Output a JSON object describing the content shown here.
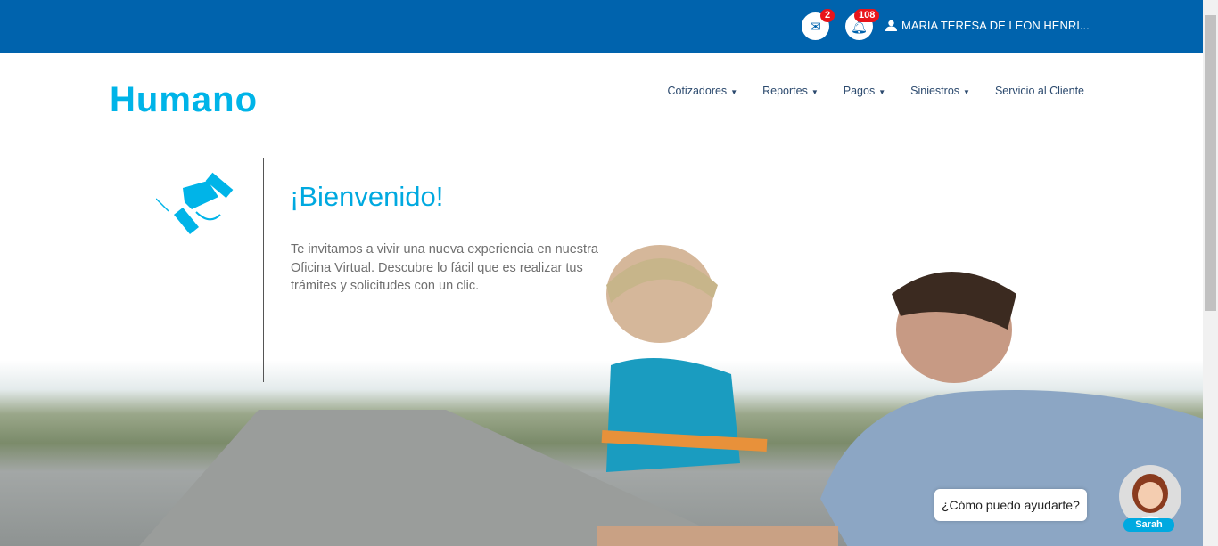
{
  "header": {
    "messages_count": "2",
    "notifications_count": "108",
    "user_name": "MARIA TERESA DE LEON HENRI...",
    "icons": [
      "mail-icon",
      "bell-icon",
      "user-icon"
    ]
  },
  "brand": {
    "logo": "Humano",
    "color": "#00b4e8",
    "topbar_color": "#0063ad"
  },
  "nav": {
    "items": [
      {
        "label": "Cotizadores",
        "dropdown": true
      },
      {
        "label": "Reportes",
        "dropdown": true
      },
      {
        "label": "Pagos",
        "dropdown": true
      },
      {
        "label": "Siniestros",
        "dropdown": true
      },
      {
        "label": "Servicio al Cliente",
        "dropdown": false
      }
    ]
  },
  "hero": {
    "title": "¡Bienvenido!",
    "description": "Te invitamos a vivir una nueva experiencia en nuestra Oficina Virtual. Descubre lo fácil que es realizar tus trámites y solicitudes con un clic.",
    "icon": "handshake-icon"
  },
  "chat": {
    "prompt": "¿Cómo puedo ayudarte?",
    "agent_name": "Sarah"
  }
}
